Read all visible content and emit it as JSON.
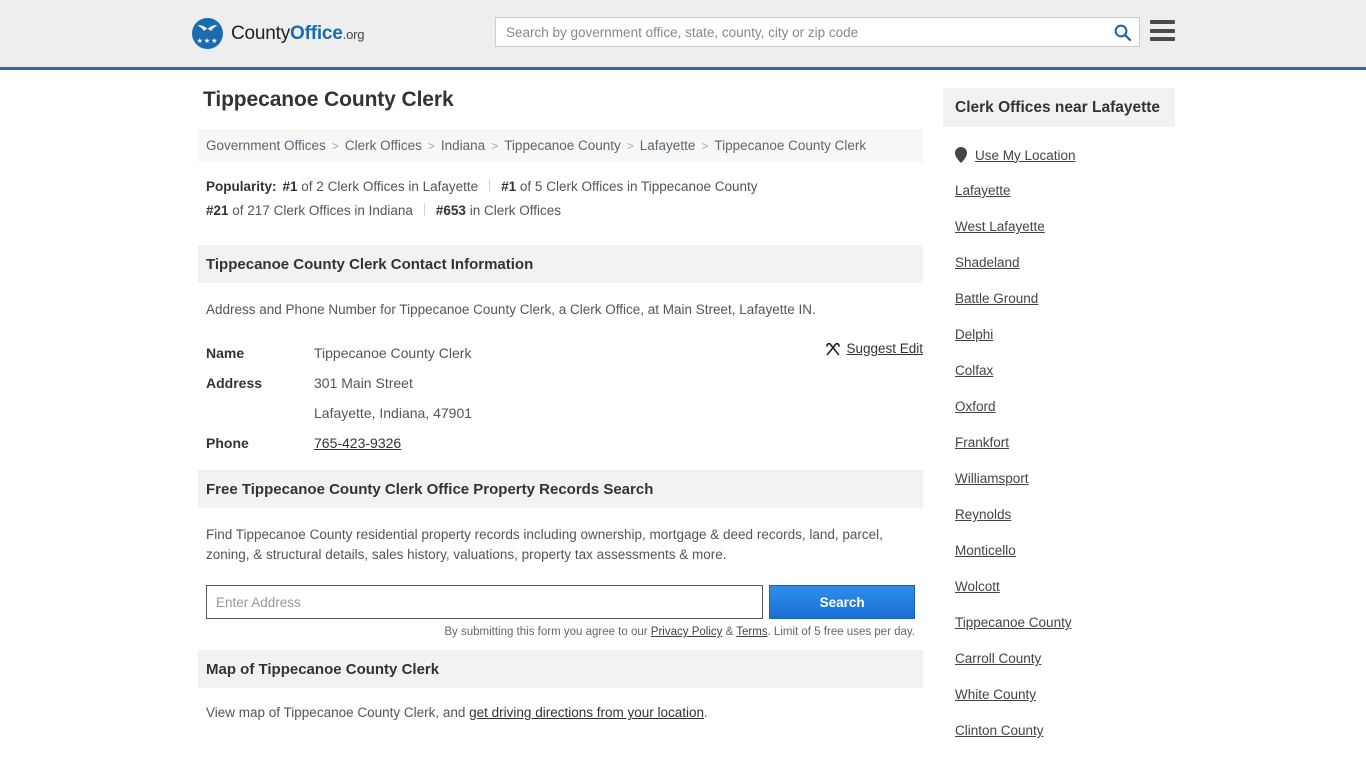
{
  "header": {
    "logo": {
      "part1": "County",
      "part2": "Office",
      "tld": ".org",
      "icon": "eagle-logo-icon"
    },
    "search_placeholder": "Search by government office, state, county, city or zip code",
    "search_value": "",
    "search_icon": "search-icon",
    "menu_icon": "hamburger-menu-icon"
  },
  "page": {
    "title": "Tippecanoe County Clerk"
  },
  "breadcrumb": {
    "separator": ">",
    "items": [
      {
        "label": "Government Offices",
        "current": false
      },
      {
        "label": "Clerk Offices",
        "current": false
      },
      {
        "label": "Indiana",
        "current": false
      },
      {
        "label": "Tippecanoe County",
        "current": false
      },
      {
        "label": "Lafayette",
        "current": false
      },
      {
        "label": "Tippecanoe County Clerk",
        "current": true
      }
    ]
  },
  "popularity": {
    "label": "Popularity:",
    "items": [
      {
        "rank": "#1",
        "text": " of 2 Clerk Offices in Lafayette"
      },
      {
        "rank": "#1",
        "text": " of 5 Clerk Offices in Tippecanoe County"
      },
      {
        "rank": "#21",
        "text": " of 217 Clerk Offices in Indiana"
      },
      {
        "rank": "#653",
        "text": " in Clerk Offices"
      }
    ]
  },
  "contact": {
    "heading": "Tippecanoe County Clerk Contact Information",
    "description": "Address and Phone Number for Tippecanoe County Clerk, a Clerk Office, at Main Street, Lafayette IN.",
    "rows": [
      {
        "label": "Name",
        "value": "Tippecanoe County Clerk",
        "type": "text"
      },
      {
        "label": "Address",
        "value": "301 Main Street",
        "type": "text"
      },
      {
        "label": "",
        "value": "Lafayette, Indiana, 47901",
        "type": "text"
      },
      {
        "label": "Phone",
        "value": "765-423-9326",
        "type": "link"
      }
    ],
    "suggest_edit": {
      "label": "Suggest Edit",
      "icon": "edit-pencil-icon"
    }
  },
  "property_search": {
    "heading": "Free Tippecanoe County Clerk Office Property Records Search",
    "description": "Find Tippecanoe County residential property records including ownership, mortgage & deed records, land, parcel, zoning, & structural details, sales history, valuations, property tax assessments & more.",
    "input_placeholder": "Enter Address",
    "input_value": "",
    "button_label": "Search",
    "disclaimer_prefix": "By submitting this form you agree to our ",
    "privacy_label": "Privacy Policy",
    "disclaimer_amp": " & ",
    "terms_label": "Terms",
    "disclaimer_suffix": ". Limit of 5 free uses per day."
  },
  "map": {
    "heading": "Map of Tippecanoe County Clerk",
    "description_prefix": "View map of Tippecanoe County Clerk, and ",
    "link_label": "get driving directions from your location",
    "description_suffix": "."
  },
  "sidebar": {
    "heading": "Clerk Offices near Lafayette",
    "use_my_location": {
      "label": "Use My Location",
      "icon": "map-pin-icon"
    },
    "links": [
      "Lafayette",
      "West Lafayette",
      "Shadeland",
      "Battle Ground",
      "Delphi",
      "Colfax",
      "Oxford",
      "Frankfort",
      "Williamsport",
      "Reynolds",
      "Monticello",
      "Wolcott",
      "Tippecanoe County",
      "Carroll County",
      "White County",
      "Clinton County"
    ]
  },
  "colors": {
    "brand_blue": "#1a6bb0",
    "header_border": "#2d6ca2",
    "button_blue": "#1a6fd4",
    "header_bg": "#eeeeee",
    "section_bg": "#f2f2f2"
  }
}
